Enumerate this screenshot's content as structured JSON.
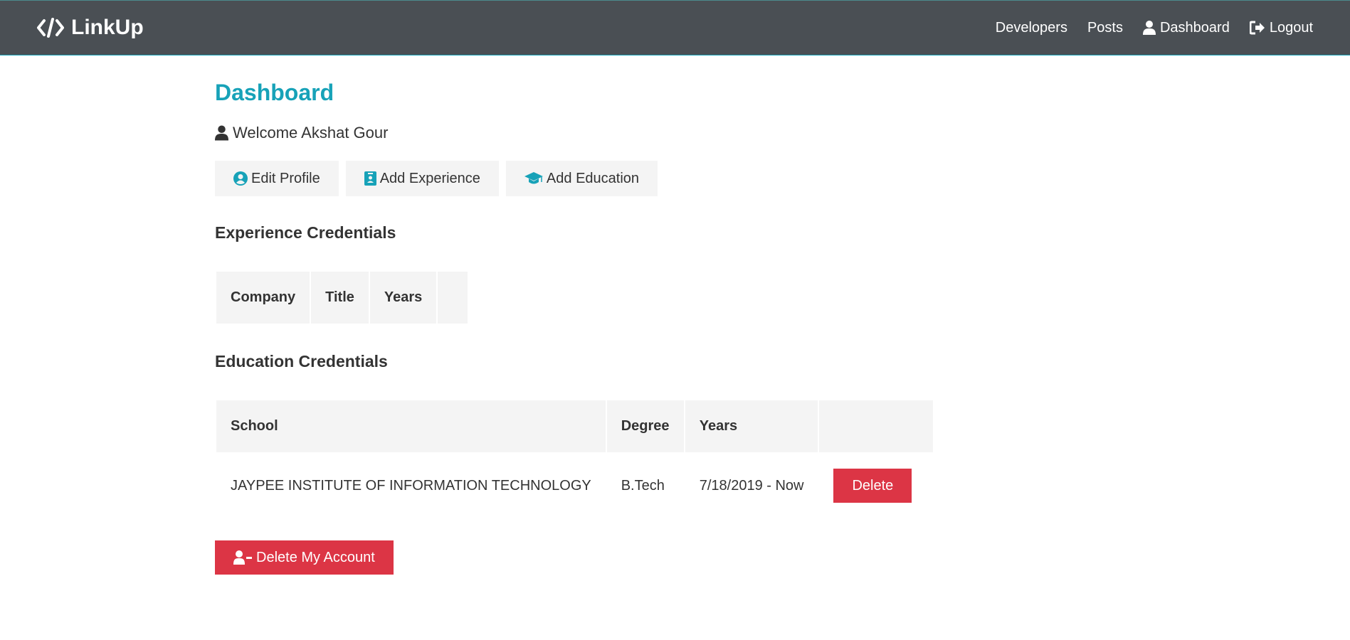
{
  "navbar": {
    "brand": "LinkUp",
    "links": {
      "developers": "Developers",
      "posts": "Posts",
      "dashboard": "Dashboard",
      "logout": "Logout"
    }
  },
  "page": {
    "title": "Dashboard",
    "welcome": "Welcome Akshat Gour"
  },
  "actions": {
    "edit_profile": "Edit Profile",
    "add_experience": "Add Experience",
    "add_education": "Add Education"
  },
  "experience": {
    "title": "Experience Credentials",
    "headers": [
      "Company",
      "Title",
      "Years",
      ""
    ]
  },
  "education": {
    "title": "Education Credentials",
    "headers": [
      "School",
      "Degree",
      "Years",
      ""
    ],
    "rows": [
      {
        "school": "JAYPEE INSTITUTE OF INFORMATION TECHNOLOGY",
        "degree": "B.Tech",
        "years": "7/18/2019 - Now",
        "delete_label": "Delete"
      }
    ]
  },
  "delete_account": {
    "label": "Delete My Account"
  },
  "colors": {
    "navbar": "#4a4f54",
    "accent": "#17a2b8",
    "danger": "#dc3545",
    "light": "#f4f4f4"
  }
}
